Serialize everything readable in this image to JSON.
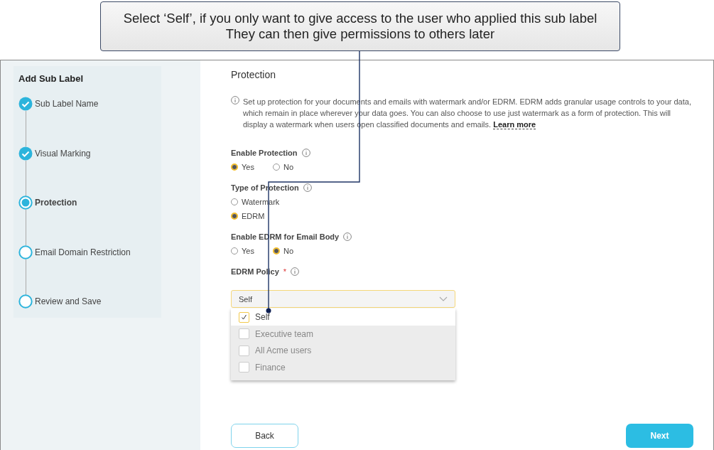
{
  "callout": {
    "lines": [
      "Select ‘Self’, if you only want to give access to the user who applied this sub label",
      "They can then give permissions to others later"
    ]
  },
  "sidebar": {
    "title": "Add Sub Label",
    "steps": [
      {
        "label": "Sub Label Name",
        "completed": true,
        "selected": false
      },
      {
        "label": "Visual Marking",
        "completed": true,
        "selected": false
      },
      {
        "label": "Protection",
        "completed": false,
        "selected": true
      },
      {
        "label": "Email Domain Restriction",
        "completed": false,
        "selected": false
      },
      {
        "label": "Review and Save",
        "completed": false,
        "selected": false
      }
    ]
  },
  "main": {
    "title": "Protection",
    "info": "Set up protection for your documents and emails with watermark and/or EDRM. EDRM adds granular usage controls to your data, which remain in place wherever your data goes. You can also choose to use just watermark as a form of protection. This will display a watermark when users open classified documents and emails.",
    "info_link": "Learn more",
    "groups": [
      {
        "label": "Enable Protection",
        "kind": "inline",
        "options": [
          {
            "label": "Yes",
            "selected": true
          },
          {
            "label": "No",
            "selected": false
          }
        ]
      },
      {
        "label": "Type of Protection",
        "kind": "stacked",
        "options": [
          {
            "label": "Watermark",
            "selected": false
          },
          {
            "label": "EDRM",
            "selected": true
          }
        ]
      },
      {
        "label": "Enable EDRM for Email Body",
        "kind": "inline",
        "options": [
          {
            "label": "Yes",
            "selected": false
          },
          {
            "label": "No",
            "selected": true
          }
        ]
      }
    ],
    "policy": {
      "label": "EDRM Policy",
      "required_mark": "*",
      "value": "Self",
      "expanded": true,
      "options": [
        {
          "label": "Self",
          "checked": true,
          "selected": true
        },
        {
          "label": "Executive team",
          "checked": false,
          "selected": false
        },
        {
          "label": "All Acme users",
          "checked": false,
          "selected": false
        },
        {
          "label": "Finance",
          "checked": false,
          "selected": false
        }
      ]
    },
    "buttons": {
      "back": "Back",
      "next": "Next"
    }
  }
}
